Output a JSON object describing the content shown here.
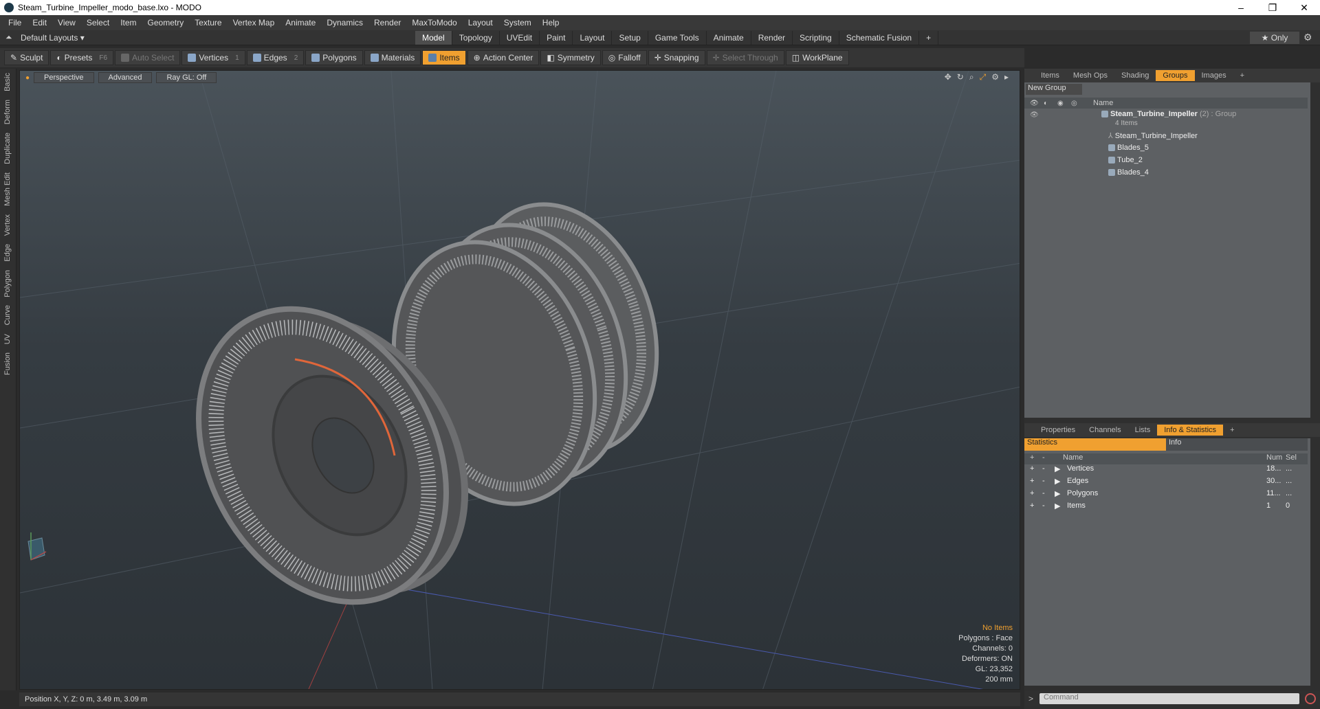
{
  "window": {
    "title": "Steam_Turbine_Impeller_modo_base.lxo - MODO",
    "controls": [
      "–",
      "❐",
      "✕"
    ]
  },
  "menu": [
    "File",
    "Edit",
    "View",
    "Select",
    "Item",
    "Geometry",
    "Texture",
    "Vertex Map",
    "Animate",
    "Dynamics",
    "Render",
    "MaxToModo",
    "Layout",
    "System",
    "Help"
  ],
  "layout": {
    "dropdown": "Default Layouts ▾",
    "tabs": [
      "Model",
      "Topology",
      "UVEdit",
      "Paint",
      "Layout",
      "Setup",
      "Game Tools",
      "Animate",
      "Render",
      "Scripting",
      "Schematic Fusion",
      "+"
    ],
    "active_tab": "Model",
    "only_label": "★  Only"
  },
  "toolbar": {
    "sculpt": "Sculpt",
    "presets": "Presets",
    "presets_key": "F6",
    "auto_select": "Auto Select",
    "vertices": "Vertices",
    "vertices_key": "1",
    "edges": "Edges",
    "edges_key": "2",
    "polygons": "Polygons",
    "materials": "Materials",
    "items": "Items",
    "action_center": "Action Center",
    "symmetry": "Symmetry",
    "falloff": "Falloff",
    "snapping": "Snapping",
    "select_through": "Select Through",
    "workplane": "WorkPlane"
  },
  "left_tabs": [
    "Basic",
    "Deform",
    "Duplicate",
    "Mesh Edit",
    "Vertex",
    "Edge",
    "Polygon",
    "Curve",
    "UV",
    "Fusion"
  ],
  "viewport": {
    "perspective": "Perspective",
    "advanced": "Advanced",
    "raygl": "Ray GL: Off",
    "info": {
      "no_items": "No Items",
      "polygons": "Polygons : Face",
      "channels": "Channels: 0",
      "deformers": "Deformers: ON",
      "gl": "GL: 23,352",
      "scale": "200 mm"
    }
  },
  "status": {
    "position": "Position X, Y, Z:  0 m, 3.49 m, 3.09 m"
  },
  "groups_panel": {
    "tabs": [
      "Items",
      "Mesh Ops",
      "Shading",
      "Groups",
      "Images",
      "+"
    ],
    "active_tab": "Groups",
    "new_group": "New Group",
    "col_name": "Name",
    "group_name": "Steam_Turbine_Impeller",
    "group_count": "(2)",
    "group_type": ": Group",
    "group_items": "4 Items",
    "children": [
      "Steam_Turbine_Impeller",
      "Blades_5",
      "Tube_2",
      "Blades_4"
    ]
  },
  "stats_panel": {
    "tabs": [
      "Properties",
      "Channels",
      "Lists",
      "Info & Statistics",
      "+"
    ],
    "active_tab": "Info & Statistics",
    "sub_tabs": [
      "Statistics",
      "Info"
    ],
    "cols": {
      "name": "Name",
      "num": "Num",
      "sel": "Sel"
    },
    "rows": [
      {
        "name": "Vertices",
        "num": "18...",
        "sel": "..."
      },
      {
        "name": "Edges",
        "num": "30...",
        "sel": "..."
      },
      {
        "name": "Polygons",
        "num": "11...",
        "sel": "..."
      },
      {
        "name": "Items",
        "num": "1",
        "sel": "0"
      }
    ]
  },
  "command": {
    "placeholder": "Command"
  }
}
